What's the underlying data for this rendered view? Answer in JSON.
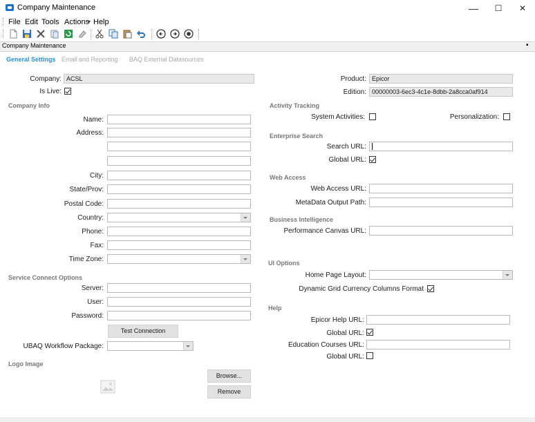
{
  "window": {
    "title": "Company Maintenance",
    "minimize": "—",
    "maximize": "☐",
    "close": "✕"
  },
  "menu": [
    "File",
    "Edit",
    "Tools",
    "Actions",
    "Help"
  ],
  "panel": {
    "title": "Company Maintenance",
    "pin": "▪"
  },
  "tabs": [
    "General Settings",
    "Email and Reporting",
    "BAQ External Datasources"
  ],
  "left": {
    "company_label": "Company:",
    "company_value": "ACSL",
    "islive_label": "Is Live:",
    "islive_checked": true,
    "company_info_header": "Company Info",
    "name_label": "Name:",
    "address_label": "Address:",
    "city_label": "City:",
    "state_label": "State/Prov:",
    "postal_label": "Postal Code:",
    "country_label": "Country:",
    "phone_label": "Phone:",
    "fax_label": "Fax:",
    "timezone_label": "Time Zone:",
    "service_header": "Service Connect Options",
    "server_label": "Server:",
    "user_label": "User:",
    "password_label": "Password:",
    "test_connection": "Test Connection",
    "ubaq_label": "UBAQ Workflow Package:",
    "logo_header": "Logo Image",
    "browse": "Browse...",
    "remove": "Remove"
  },
  "right": {
    "product_label": "Product:",
    "product_value": "Epicor",
    "edition_label": "Edition:",
    "edition_value": "00000003-6ec3-4c1e-8dbb-2a8cca0af914",
    "activity_header": "Activity Tracking",
    "system_activities_label": "System Activities:",
    "personalization_label": "Personalization:",
    "enterprise_header": "Enterprise Search",
    "search_url_label": "Search URL:",
    "global_url_label": "Global URL:",
    "web_header": "Web Access",
    "web_access_url_label": "Web Access URL:",
    "metadata_label": "MetaData Output Path:",
    "bi_header": "Business Intelligence",
    "perf_canvas_label": "Performance Canvas URL:",
    "ui_header": "UI Options",
    "home_layout_label": "Home Page Layout:",
    "dyn_grid_label": "Dynamic Grid Currency Columns Format",
    "help_header": "Help",
    "epicor_help_label": "Epicor Help URL:",
    "help_global_label": "Global URL:",
    "edu_label": "Education Courses URL:",
    "edu_global_label": "Global URL:"
  },
  "colors": {
    "accent": "#2a8fd6",
    "app_icon": "#1e73c8"
  }
}
